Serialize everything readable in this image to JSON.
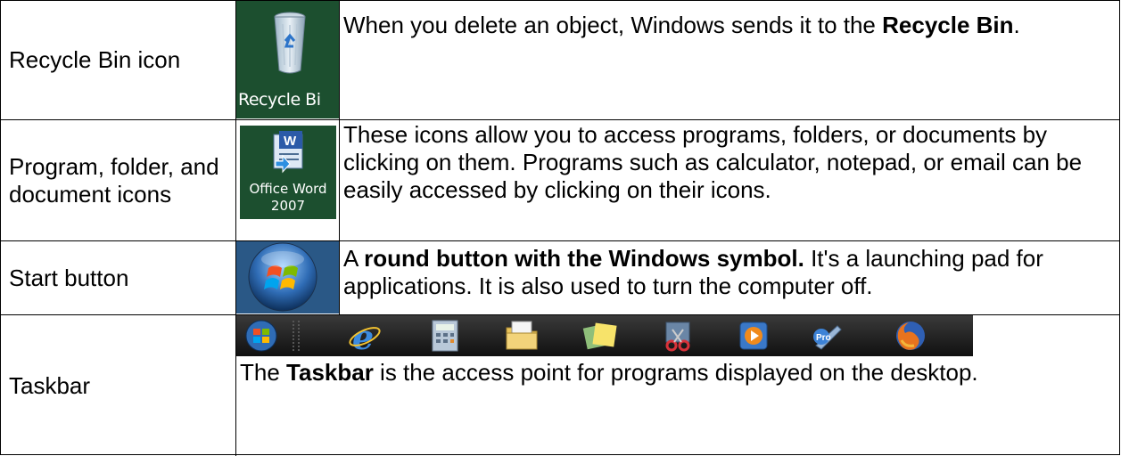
{
  "rows": [
    {
      "name": "Recycle Bin icon",
      "icon_label": "Recycle Bi",
      "desc_pre": "When you delete an object, Windows sends it to the ",
      "desc_bold": "Recycle Bin",
      "desc_post": "."
    },
    {
      "name": "Program, folder, and document icons",
      "icon_label_1": "Office Word",
      "icon_label_2": "2007",
      "desc": "These icons allow you to access programs, folders, or documents by clicking on them. Programs such as calculator, notepad, or email can be easily accessed by clicking on their icons."
    },
    {
      "name": "Start button",
      "desc_pre": "A ",
      "desc_bold": "round button with the Windows symbol.",
      "desc_post": " It's a launching pad for applications. It is also used to turn the computer off."
    },
    {
      "name": "Taskbar",
      "desc_pre": "The ",
      "desc_bold": "Taskbar",
      "desc_post": " is the access point for programs displayed on the desktop.",
      "taskbar_icons": [
        "windows-start-icon",
        "internet-explorer-icon",
        "calculator-icon",
        "file-explorer-icon",
        "sticky-notes-icon",
        "snipping-tool-icon",
        "media-player-icon",
        "paint-icon",
        "firefox-icon"
      ]
    }
  ],
  "colors": {
    "desktop_green": "#1c4f2f",
    "start_blue": "#2a5886",
    "taskbar_dark": "#1a1a1a"
  }
}
